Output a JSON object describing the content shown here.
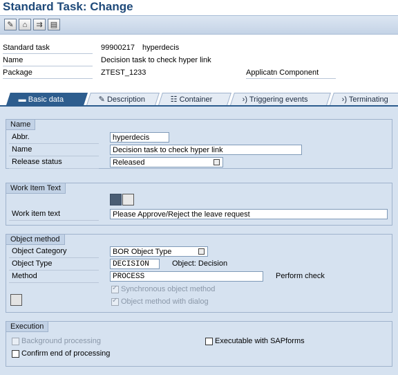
{
  "window": {
    "title": "Standard Task: Change"
  },
  "toolbar": {
    "buttons": [
      "edit-icon",
      "org-icon",
      "hierarchy-icon",
      "workflow-icon"
    ]
  },
  "header": {
    "standard_task_label": "Standard task",
    "standard_task_id": "99900217",
    "standard_task_abbr": "hyperdecis",
    "name_label": "Name",
    "name_value": "Decision task to check hyper link",
    "package_label": "Package",
    "package_value": "ZTEST_1233",
    "app_component_label": "Applicatn Component"
  },
  "tabs": [
    {
      "label": "Basic data"
    },
    {
      "label": "Description"
    },
    {
      "label": "Container"
    },
    {
      "label": "Triggering events"
    },
    {
      "label": "Terminating"
    }
  ],
  "name_group": {
    "title": "Name",
    "abbr_label": "Abbr.",
    "abbr_value": "hyperdecis",
    "name_label": "Name",
    "name_value": "Decision task to check hyper link",
    "release_label": "Release status",
    "release_value": "Released"
  },
  "workitem_group": {
    "title": "Work Item Text",
    "text_label": "Work item text",
    "text_value": "Please Approve/Reject the leave request"
  },
  "object_group": {
    "title": "Object method",
    "category_label": "Object Category",
    "category_value": "BOR Object Type",
    "type_label": "Object Type",
    "type_value": "DECISION",
    "type_desc": "Object: Decision",
    "method_label": "Method",
    "method_value": "PROCESS",
    "method_desc": "Perform check",
    "sync_label": "Synchronous object method",
    "dialog_label": "Object method with dialog"
  },
  "exec_group": {
    "title": "Execution",
    "background_label": "Background processing",
    "sapforms_label": "Executable with SAPforms",
    "confirm_label": "Confirm end of processing"
  },
  "colors": {
    "accent": "#2d5d8e",
    "panel": "#d6e2f0",
    "title": "#1f4a7a"
  }
}
